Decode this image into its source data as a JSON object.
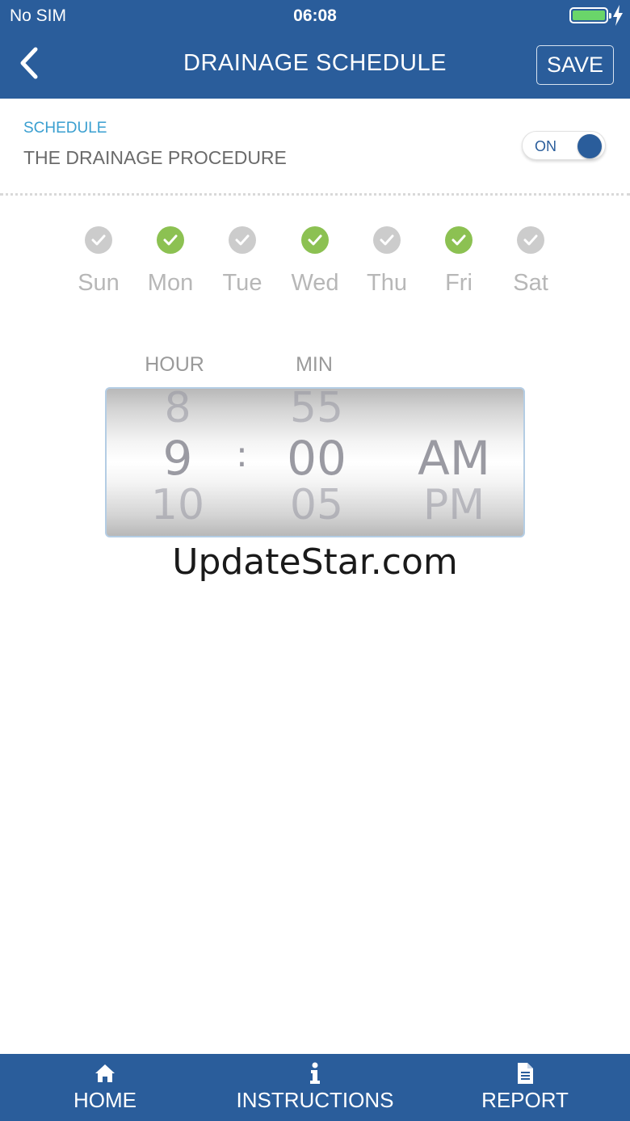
{
  "status_bar": {
    "carrier": "No SIM",
    "time": "06:08",
    "battery_icon": "battery-icon",
    "charging_icon": "bolt-icon"
  },
  "nav": {
    "title": "DRAINAGE SCHEDULE",
    "save_label": "SAVE",
    "back_icon": "chevron-left-icon"
  },
  "schedule": {
    "caption": "SCHEDULE",
    "title": "THE DRAINAGE PROCEDURE",
    "toggle_label": "ON",
    "toggle_on": true
  },
  "days": [
    {
      "label": "Sun",
      "checked": false
    },
    {
      "label": "Mon",
      "checked": true
    },
    {
      "label": "Tue",
      "checked": false
    },
    {
      "label": "Wed",
      "checked": true
    },
    {
      "label": "Thu",
      "checked": false
    },
    {
      "label": "Fri",
      "checked": true
    },
    {
      "label": "Sat",
      "checked": false
    }
  ],
  "picker": {
    "hour_header": "HOUR",
    "min_header": "MIN",
    "separator": ":",
    "hour": {
      "prev": "8",
      "selected": "9",
      "next": "10"
    },
    "minute": {
      "prev": "55",
      "selected": "00",
      "next": "05"
    },
    "period": {
      "selected": "AM",
      "next": "PM"
    }
  },
  "watermark": "UpdateStar.com",
  "tabs": [
    {
      "label": "HOME",
      "icon": "home-icon"
    },
    {
      "label": "INSTRUCTIONS",
      "icon": "info-icon"
    },
    {
      "label": "REPORT",
      "icon": "document-icon"
    }
  ],
  "colors": {
    "brand_blue": "#2a5d9b",
    "check_on": "#8cc152",
    "check_off": "#cccccc",
    "caption_blue": "#3a9fd0"
  }
}
